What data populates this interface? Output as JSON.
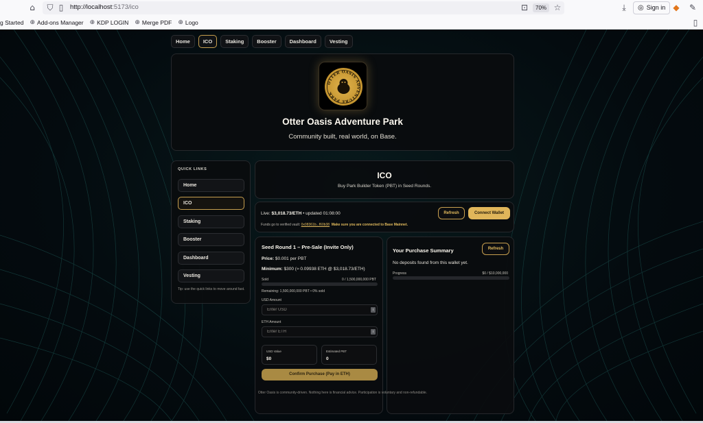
{
  "browser": {
    "url_host": "http://localhost",
    "url_path": ":5173/ico",
    "zoom": "70%",
    "signin_label": "Sign in",
    "bookmarks": [
      "g Started",
      "Add-ons Manager",
      "KDP LOGIN",
      "Merge PDF",
      "Logo"
    ]
  },
  "nav": {
    "items": [
      "Home",
      "ICO",
      "Staking",
      "Booster",
      "Dashboard",
      "Vesting"
    ],
    "active": "ICO"
  },
  "hero": {
    "logo_text": "OTTER OASIS ADVENTURE PARK",
    "title": "Otter Oasis Adventure Park",
    "subtitle": "Community built, real world, on Base."
  },
  "quick_links": {
    "title": "QUICK LINKS",
    "items": [
      "Home",
      "ICO",
      "Staking",
      "Booster",
      "Dashboard",
      "Vesting"
    ],
    "active": "ICO",
    "tip": "Tip: use the quick links to move around fast."
  },
  "ico": {
    "title": "ICO",
    "subtitle": "Buy Park Builder Token (PBT) in Seed Rounds."
  },
  "live": {
    "label": "Live:",
    "price": "$3,018.73/ETH",
    "updated": "• updated 01:08:00",
    "vault_label": "Funds go to verified vault:",
    "vault_address": "0x08361b...f60b38",
    "warning": "Make sure you are connected to Base Mainnet.",
    "refresh_label": "Refresh",
    "connect_label": "Connect Wallet"
  },
  "seed": {
    "title": "Seed Round 1 – Pre-Sale (Invite Only)",
    "price_label": "Price:",
    "price_value": "$0.001 per PBT",
    "minimum_label": "Minimum:",
    "minimum_value": "$300 (≈ 0.09938 ETH @ $3,018.73/ETH)",
    "sold_label": "Sold",
    "sold_value": "0 / 1,500,000,000 PBT",
    "sold_fraction": 0,
    "remaining": "Remaining: 1,500,000,000 PBT • 0% sold",
    "usd_label": "USD Amount",
    "usd_placeholder": "Enter USD",
    "eth_label": "ETH Amount",
    "eth_placeholder": "Enter ETH",
    "usd_value_label": "USD Value",
    "usd_value": "$0",
    "est_label": "Estimated PBT",
    "est_value": "0",
    "confirm_label": "Confirm Purchase (Pay in ETH)"
  },
  "summary": {
    "title": "Your Purchase Summary",
    "refresh_label": "Refresh",
    "empty": "No deposits found from this wallet yet.",
    "progress_label": "Progress",
    "progress_value": "$0 / $10,000,000",
    "progress_fraction": 0
  },
  "footer": "Otter Oasis is community-driven. Nothing here is financial advice. Participation is voluntary and non-refundable.",
  "colors": {
    "gold": "#e0b65a",
    "background": "#040b0f",
    "card": "#0a0c0e"
  }
}
